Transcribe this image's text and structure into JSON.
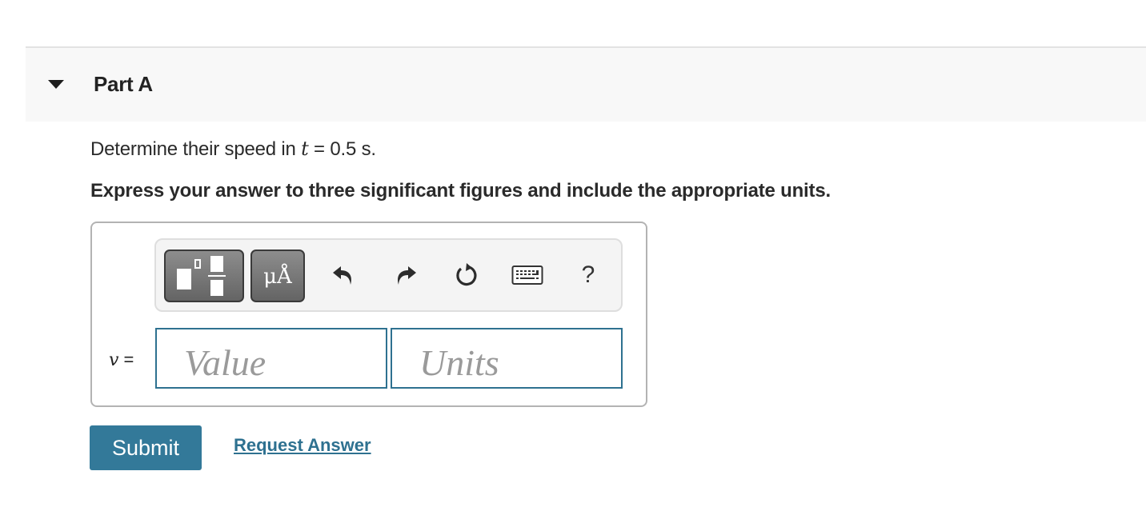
{
  "part": {
    "title": "Part A",
    "expanded": true
  },
  "question": {
    "prefix": "Determine their speed in ",
    "variable": "t",
    "suffix": " = 0.5 s."
  },
  "instruction": "Express your answer to three significant figures and include the appropriate units.",
  "toolbar": {
    "buttons": [
      {
        "name": "templates",
        "icon": "templates-icon"
      },
      {
        "name": "units",
        "label": "μÅ",
        "icon": "units-icon"
      },
      {
        "name": "undo",
        "icon": "undo-icon"
      },
      {
        "name": "redo",
        "icon": "redo-icon"
      },
      {
        "name": "reset",
        "icon": "reset-icon"
      },
      {
        "name": "keyboard",
        "icon": "keyboard-icon"
      },
      {
        "name": "help",
        "label": "?",
        "icon": "help-icon"
      }
    ]
  },
  "answer": {
    "variable": "v",
    "equals": " =",
    "value_placeholder": "Value",
    "units_placeholder": "Units",
    "value": "",
    "units": ""
  },
  "actions": {
    "submit_label": "Submit",
    "request_label": "Request Answer"
  },
  "colors": {
    "accent": "#337999",
    "field_border": "#2e7190",
    "header_bg": "#f8f8f8"
  }
}
